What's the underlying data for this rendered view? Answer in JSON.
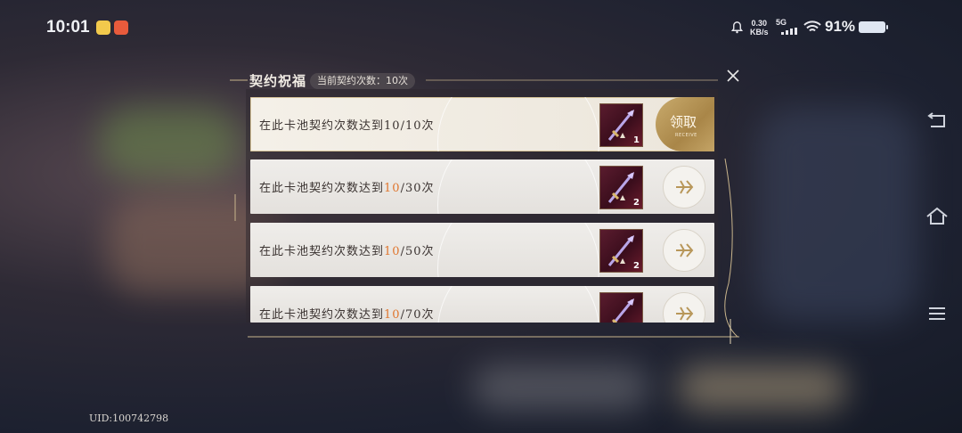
{
  "status_bar": {
    "time": "10:01",
    "net_speed_value": "0.30",
    "net_speed_unit": "KB/s",
    "network_type": "5G",
    "battery_percent": "91%"
  },
  "dialog": {
    "title": "契约祝福",
    "current_count": "当前契约次数：10次",
    "rows": [
      {
        "prefix": "在此卡池契约次数达到",
        "progress": "10",
        "target": "/10次",
        "reward_qty": "1",
        "state": "claimable",
        "button_label": "领取",
        "button_sub": "RECEIVE"
      },
      {
        "prefix": "在此卡池契约次数达到",
        "progress": "10",
        "target": "/30次",
        "reward_qty": "2",
        "state": "locked"
      },
      {
        "prefix": "在此卡池契约次数达到",
        "progress": "10",
        "target": "/50次",
        "reward_qty": "2",
        "state": "locked"
      },
      {
        "prefix": "在此卡池契约次数达到",
        "progress": "10",
        "target": "/70次",
        "reward_qty": "",
        "state": "locked"
      }
    ]
  },
  "footer": {
    "uid": "UID:100742798"
  },
  "colors": {
    "highlight": "#e0762f",
    "gold": "#b8975a"
  }
}
